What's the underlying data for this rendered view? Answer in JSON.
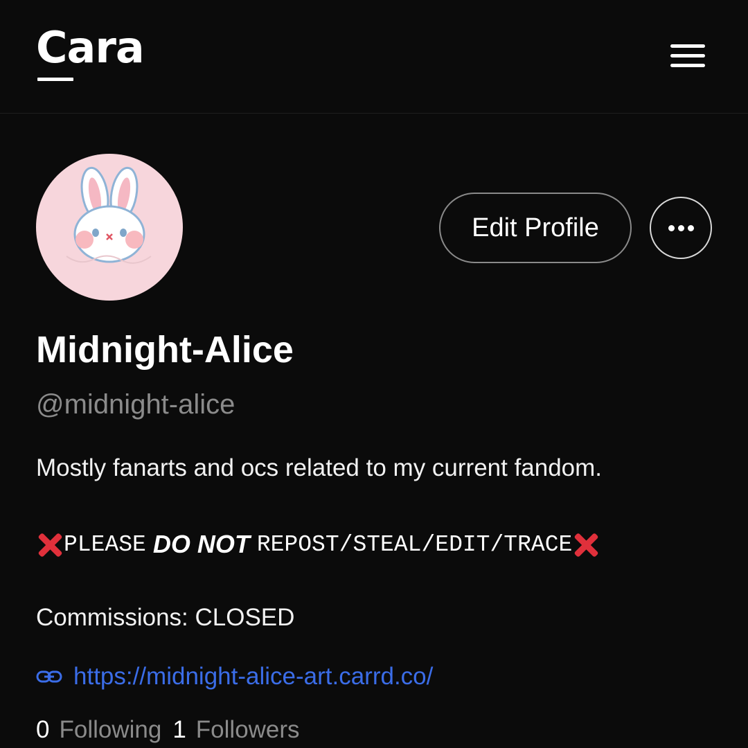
{
  "header": {
    "logo": "Cara",
    "menu_icon": "hamburger-menu-icon"
  },
  "profile": {
    "avatar_icon": "bunny-avatar",
    "edit_button": "Edit Profile",
    "more_icon": "more-options-icon",
    "display_name": "Midnight-Alice",
    "handle": "@midnight-alice",
    "bio_line": "Mostly fanarts and ocs related to my current fandom.",
    "warning": {
      "prefix": "PLEASE",
      "emphasis": "DO NOT",
      "suffix": "REPOST/STEAL/EDIT/TRACE",
      "icon": "red-x-icon"
    },
    "commissions": "Commissions: CLOSED",
    "link": "https://midnight-alice-art.carrd.co/",
    "link_icon": "link-icon",
    "following_count": "0",
    "following_label": "Following",
    "followers_count": "1",
    "followers_label": "Followers"
  },
  "colors": {
    "background": "#0b0b0b",
    "link": "#3b6de8",
    "muted_text": "#8b8b8b",
    "avatar_bg": "#f7d6dc",
    "warning_x": "#e0303b"
  }
}
